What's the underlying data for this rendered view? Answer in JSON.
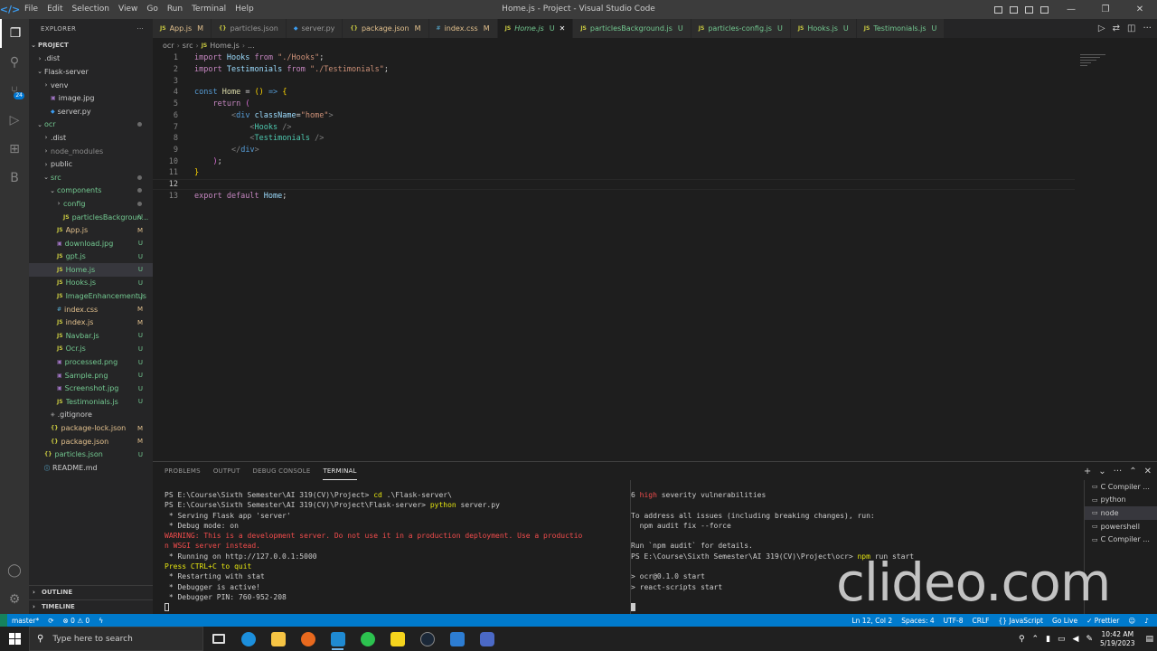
{
  "window": {
    "title": "Home.js - Project - Visual Studio Code",
    "menu": [
      "File",
      "Edit",
      "Selection",
      "View",
      "Go",
      "Run",
      "Terminal",
      "Help"
    ]
  },
  "explorer": {
    "header": "EXPLORER",
    "more": "···",
    "project": "PROJECT",
    "outline": "OUTLINE",
    "timeline": "TIMELINE",
    "source_control_badge": "24"
  },
  "tree": [
    {
      "indent": 1,
      "chev": "›",
      "name": ".dist",
      "type": "folder"
    },
    {
      "indent": 1,
      "chev": "⌄",
      "name": "Flask-server",
      "type": "folder"
    },
    {
      "indent": 2,
      "chev": "›",
      "name": "venv",
      "type": "folder"
    },
    {
      "indent": 2,
      "icon": "img",
      "name": "image.jpg",
      "type": "file"
    },
    {
      "indent": 2,
      "icon": "py",
      "name": "server.py",
      "type": "file"
    },
    {
      "indent": 1,
      "chev": "⌄",
      "name": "ocr",
      "type": "folder",
      "mod": "dot",
      "color": "c-u"
    },
    {
      "indent": 2,
      "chev": "›",
      "name": ".dist",
      "type": "folder"
    },
    {
      "indent": 2,
      "chev": "›",
      "name": "node_modules",
      "type": "folder",
      "color": "c-g"
    },
    {
      "indent": 2,
      "chev": "›",
      "name": "public",
      "type": "folder"
    },
    {
      "indent": 2,
      "chev": "⌄",
      "name": "src",
      "type": "folder",
      "mod": "dot",
      "color": "c-u"
    },
    {
      "indent": 3,
      "chev": "⌄",
      "name": "components",
      "type": "folder",
      "mod": "dot",
      "color": "c-u"
    },
    {
      "indent": 4,
      "chev": "›",
      "name": "config",
      "type": "folder",
      "mod": "dot",
      "color": "c-u"
    },
    {
      "indent": 4,
      "icon": "js",
      "name": "particlesBackgroun...",
      "type": "file",
      "status": "U",
      "color": "c-u"
    },
    {
      "indent": 3,
      "icon": "js",
      "name": "App.js",
      "type": "file",
      "status": "M",
      "color": "c-m"
    },
    {
      "indent": 3,
      "icon": "img",
      "name": "download.jpg",
      "type": "file",
      "status": "U",
      "color": "c-u"
    },
    {
      "indent": 3,
      "icon": "js",
      "name": "gpt.js",
      "type": "file",
      "status": "U",
      "color": "c-u"
    },
    {
      "indent": 3,
      "icon": "js",
      "name": "Home.js",
      "type": "file",
      "status": "U",
      "color": "c-u",
      "selected": true
    },
    {
      "indent": 3,
      "icon": "js",
      "name": "Hooks.js",
      "type": "file",
      "status": "U",
      "color": "c-u"
    },
    {
      "indent": 3,
      "icon": "js",
      "name": "ImageEnhancement.js",
      "type": "file",
      "status": "U",
      "color": "c-u"
    },
    {
      "indent": 3,
      "icon": "css",
      "name": "index.css",
      "type": "file",
      "status": "M",
      "color": "c-m"
    },
    {
      "indent": 3,
      "icon": "js",
      "name": "index.js",
      "type": "file",
      "status": "M",
      "color": "c-m"
    },
    {
      "indent": 3,
      "icon": "js",
      "name": "Navbar.js",
      "type": "file",
      "status": "U",
      "color": "c-u"
    },
    {
      "indent": 3,
      "icon": "js",
      "name": "Ocr.js",
      "type": "file",
      "status": "U",
      "color": "c-u"
    },
    {
      "indent": 3,
      "icon": "img",
      "name": "processed.png",
      "type": "file",
      "status": "U",
      "color": "c-u"
    },
    {
      "indent": 3,
      "icon": "img",
      "name": "Sample.png",
      "type": "file",
      "status": "U",
      "color": "c-u"
    },
    {
      "indent": 3,
      "icon": "img",
      "name": "Screenshot.jpg",
      "type": "file",
      "status": "U",
      "color": "c-u"
    },
    {
      "indent": 3,
      "icon": "js",
      "name": "Testimonials.js",
      "type": "file",
      "status": "U",
      "color": "c-u"
    },
    {
      "indent": 2,
      "icon": "git",
      "name": ".gitignore",
      "type": "file"
    },
    {
      "indent": 2,
      "icon": "json",
      "name": "package-lock.json",
      "type": "file",
      "status": "M",
      "color": "c-m"
    },
    {
      "indent": 2,
      "icon": "json",
      "name": "package.json",
      "type": "file",
      "status": "M",
      "color": "c-m"
    },
    {
      "indent": 1,
      "icon": "json",
      "name": "particles.json",
      "type": "file",
      "status": "U",
      "color": "c-u"
    },
    {
      "indent": 1,
      "icon": "md",
      "name": "README.md",
      "type": "file"
    }
  ],
  "tabs": [
    {
      "icon": "JS",
      "icon_type": "js",
      "label": "App.js",
      "status": "M",
      "color": "c-m"
    },
    {
      "icon": "{}",
      "icon_type": "json",
      "label": "particles.json",
      "status": "",
      "color": ""
    },
    {
      "icon": "◆",
      "icon_type": "py",
      "label": "server.py",
      "status": "",
      "color": ""
    },
    {
      "icon": "{}",
      "icon_type": "json",
      "label": "package.json",
      "status": "M",
      "color": "c-m"
    },
    {
      "icon": "#",
      "icon_type": "css",
      "label": "index.css",
      "status": "M",
      "color": "c-m"
    },
    {
      "icon": "JS",
      "icon_type": "js",
      "label": "Home.js",
      "status": "U",
      "color": "c-u",
      "active": true
    },
    {
      "icon": "JS",
      "icon_type": "js",
      "label": "particlesBackground.js",
      "status": "U",
      "color": "c-u"
    },
    {
      "icon": "JS",
      "icon_type": "js",
      "label": "particles-config.js",
      "status": "U",
      "color": "c-u"
    },
    {
      "icon": "JS",
      "icon_type": "js",
      "label": "Hooks.js",
      "status": "U",
      "color": "c-u"
    },
    {
      "icon": "JS",
      "icon_type": "js",
      "label": "Testimonials.js",
      "status": "U",
      "color": "c-u"
    }
  ],
  "breadcrumb": [
    "ocr",
    "src",
    "JS",
    "Home.js",
    "..."
  ],
  "code_lines": [
    [
      [
        "kw",
        "import "
      ],
      [
        "vr",
        "Hooks "
      ],
      [
        "kw",
        "from "
      ],
      [
        "str",
        "\"./Hooks\""
      ],
      [
        "pn",
        ";"
      ]
    ],
    [
      [
        "kw",
        "import "
      ],
      [
        "vr",
        "Testimonials "
      ],
      [
        "kw",
        "from "
      ],
      [
        "str",
        "\"./Testimonials\""
      ],
      [
        "pn",
        ";"
      ]
    ],
    [],
    [
      [
        "kb",
        "const "
      ],
      [
        "fn",
        "Home "
      ],
      [
        "pn",
        "= "
      ],
      [
        "br",
        "()"
      ],
      [
        "pn",
        " "
      ],
      [
        "kb",
        "=>"
      ],
      [
        "pn",
        " "
      ],
      [
        "br",
        "{"
      ]
    ],
    [
      [
        "pn",
        "    "
      ],
      [
        "kw",
        "return "
      ],
      [
        "br2",
        "("
      ]
    ],
    [
      [
        "pn",
        "        "
      ],
      [
        "tgg",
        "<"
      ],
      [
        "kb",
        "div "
      ],
      [
        "at",
        "className"
      ],
      [
        "pn",
        "="
      ],
      [
        "str",
        "\"home\""
      ],
      [
        "tgg",
        ">"
      ]
    ],
    [
      [
        "pn",
        "            "
      ],
      [
        "tgg",
        "<"
      ],
      [
        "tg",
        "Hooks "
      ],
      [
        "tgg",
        "/>"
      ]
    ],
    [
      [
        "pn",
        "            "
      ],
      [
        "tgg",
        "<"
      ],
      [
        "tg",
        "Testimonials "
      ],
      [
        "tgg",
        "/>"
      ]
    ],
    [
      [
        "pn",
        "        "
      ],
      [
        "tgg",
        "</"
      ],
      [
        "kb",
        "div"
      ],
      [
        "tgg",
        ">"
      ]
    ],
    [
      [
        "pn",
        "    "
      ],
      [
        "br2",
        ")"
      ],
      [
        "pn",
        ";"
      ]
    ],
    [
      [
        "br",
        "}"
      ]
    ],
    [],
    [
      [
        "kw",
        "export "
      ],
      [
        "kw",
        "default "
      ],
      [
        "vr",
        "Home"
      ],
      [
        "pn",
        ";"
      ]
    ]
  ],
  "panel": {
    "tabs": [
      "PROBLEMS",
      "OUTPUT",
      "DEBUG CONSOLE",
      "TERMINAL"
    ],
    "active_tab": "TERMINAL",
    "term_left": [
      [
        [
          "",
          "PS E:\\Course\\Sixth Semester\\AI 319(CV)\\Project> "
        ],
        [
          "yel",
          "cd"
        ],
        [
          "",
          " .\\Flask-server\\"
        ]
      ],
      [
        [
          "",
          "PS E:\\Course\\Sixth Semester\\AI 319(CV)\\Project\\Flask-server> "
        ],
        [
          "yel",
          "python"
        ],
        [
          "",
          " server.py"
        ]
      ],
      [
        [
          "",
          " * Serving Flask app 'server'"
        ]
      ],
      [
        [
          "",
          " * Debug mode: on"
        ]
      ],
      [
        [
          "red",
          "WARNING: This is a development server. Do not use it in a production deployment. Use a productio"
        ]
      ],
      [
        [
          "red",
          "n WSGI server instead."
        ]
      ],
      [
        [
          "",
          " * Running on http://127.0.0.1:5000"
        ]
      ],
      [
        [
          "yel",
          "Press CTRL+C to quit"
        ]
      ],
      [
        [
          "",
          " * Restarting with stat"
        ]
      ],
      [
        [
          "",
          " * Debugger is active!"
        ]
      ],
      [
        [
          "",
          " * Debugger PIN: 760-952-208"
        ]
      ]
    ],
    "term_right": [
      [
        [
          "",
          "6 "
        ],
        [
          "red",
          "high"
        ],
        [
          "",
          " severity vulnerabilities"
        ]
      ],
      [],
      [
        [
          "",
          "To address all issues (including breaking changes), run:"
        ]
      ],
      [
        [
          "",
          "  npm audit fix --force"
        ]
      ],
      [],
      [
        [
          "",
          "Run `npm audit` for details."
        ]
      ],
      [
        [
          "",
          "PS E:\\Course\\Sixth Semester\\AI 319(CV)\\Project\\ocr> "
        ],
        [
          "yel",
          "npm"
        ],
        [
          "",
          " run start"
        ]
      ],
      [],
      [
        [
          "",
          "> ocr@0.1.0 start"
        ]
      ],
      [
        [
          "",
          "> react-scripts start"
        ]
      ]
    ],
    "terminals": [
      {
        "label": "C Compiler ...",
        "active": false
      },
      {
        "label": "python",
        "active": false
      },
      {
        "label": "node",
        "active": true
      },
      {
        "label": "powershell",
        "active": false
      },
      {
        "label": "C Compiler ...",
        "active": false
      }
    ]
  },
  "status": {
    "branch": "master*",
    "errors": "⊗ 0 ⚠ 0",
    "position": "Ln 12, Col 2",
    "spaces": "Spaces: 4",
    "encoding": "UTF-8",
    "eol": "CRLF",
    "language": "{} JavaScript",
    "golive": "Go Live",
    "prettier": "✓ Prettier"
  },
  "taskbar": {
    "search_placeholder": "Type here to search",
    "time": "10:42 AM",
    "date": "5/19/2023"
  },
  "watermark": "clideo.com",
  "colors": {
    "accent": "#007acc",
    "untracked": "#73c991",
    "modified": "#e2c08d"
  }
}
